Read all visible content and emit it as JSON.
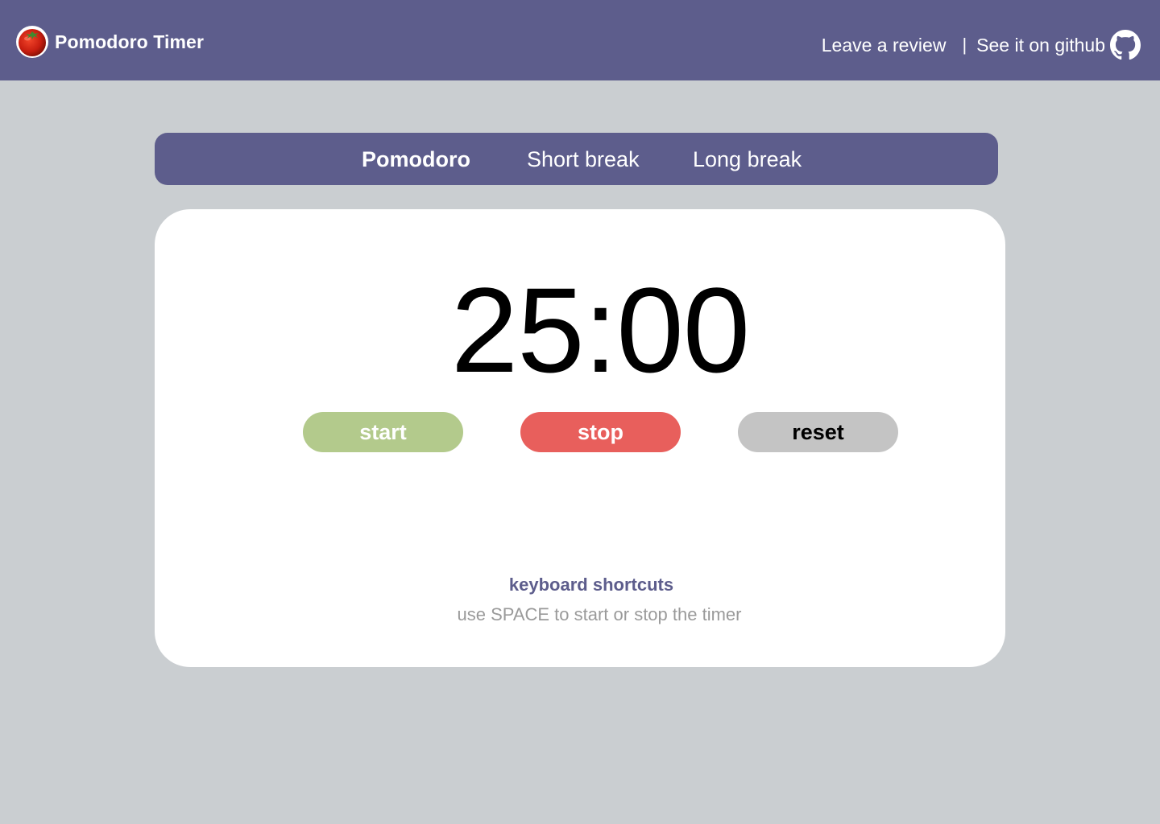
{
  "header": {
    "title": "Pomodoro Timer",
    "logo_icon": "tomato-icon",
    "links": {
      "review": "Leave a review",
      "separator": "|",
      "github": "See it on github"
    },
    "github_icon": "github-icon"
  },
  "modes": {
    "items": [
      {
        "label": "Pomodoro",
        "active": true
      },
      {
        "label": "Short break",
        "active": false
      },
      {
        "label": "Long break",
        "active": false
      }
    ]
  },
  "timer": {
    "display": "25:00"
  },
  "controls": {
    "start": "start",
    "stop": "stop",
    "reset": "reset"
  },
  "shortcuts": {
    "title": "keyboard shortcuts",
    "text": "use SPACE to start or stop the timer"
  },
  "colors": {
    "primary": "#5d5d8c",
    "background": "#caced1",
    "start": "#b3ca8c",
    "stop": "#e85f5c",
    "reset": "#c4c4c4"
  }
}
